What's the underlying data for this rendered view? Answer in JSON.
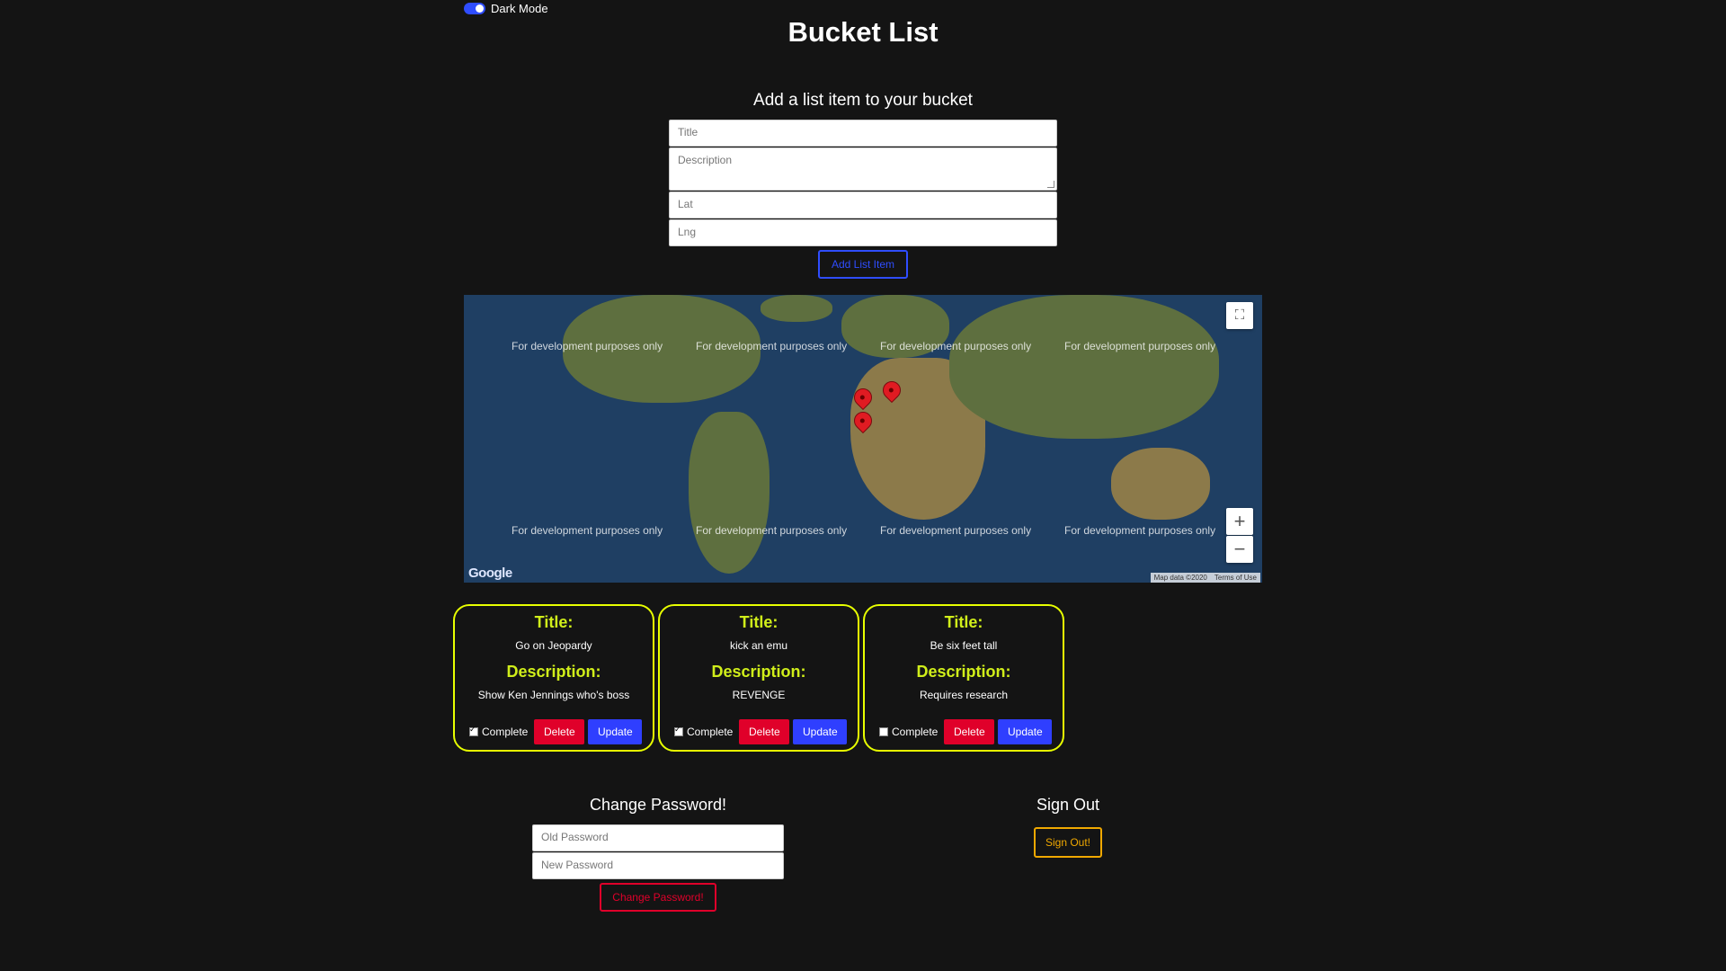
{
  "header": {
    "dark_mode_label": "Dark Mode",
    "title": "Bucket List"
  },
  "add_form": {
    "heading": "Add a list item to your bucket",
    "title_placeholder": "Title",
    "description_placeholder": "Description",
    "lat_placeholder": "Lat",
    "lng_placeholder": "Lng",
    "submit_label": "Add List Item"
  },
  "map": {
    "watermark": "For development purposes only",
    "logo": "Google",
    "map_data": "Map data ©2020",
    "terms": "Terms of Use",
    "zoom_in": "+",
    "zoom_out": "−"
  },
  "cards": [
    {
      "title_label": "Title:",
      "title": "Go on Jeopardy",
      "description_label": "Description:",
      "description": "Show Ken Jennings who's boss",
      "complete_label": "Complete",
      "complete": true,
      "delete_label": "Delete",
      "update_label": "Update"
    },
    {
      "title_label": "Title:",
      "title": "kick an emu",
      "description_label": "Description:",
      "description": "REVENGE",
      "complete_label": "Complete",
      "complete": true,
      "delete_label": "Delete",
      "update_label": "Update"
    },
    {
      "title_label": "Title:",
      "title": "Be six feet tall",
      "description_label": "Description:",
      "description": "Requires research",
      "complete_label": "Complete",
      "complete": false,
      "delete_label": "Delete",
      "update_label": "Update"
    }
  ],
  "change_password": {
    "heading": "Change Password!",
    "old_placeholder": "Old Password",
    "new_placeholder": "New Password",
    "button_label": "Change Password!"
  },
  "sign_out": {
    "heading": "Sign Out",
    "button_label": "Sign Out!"
  }
}
